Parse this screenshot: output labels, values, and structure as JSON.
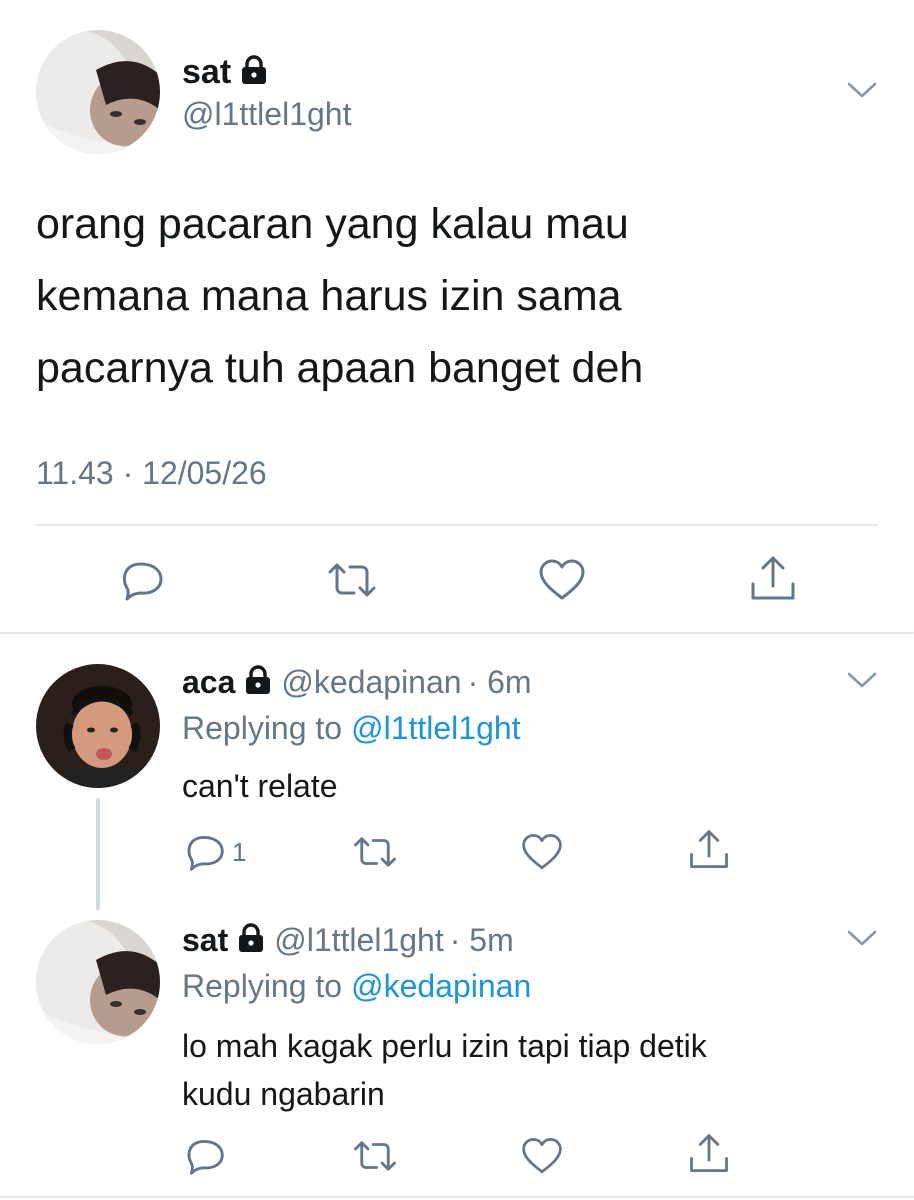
{
  "main_tweet": {
    "name": "sat",
    "handle": "@l1ttlel1ght",
    "text_lines": [
      "orang pacaran yang kalau mau",
      "kemana mana harus izin sama",
      "pacarnya tuh apaan banget deh"
    ],
    "timestamp": "11.43 · 12/05/26"
  },
  "replies": [
    {
      "name": "aca",
      "handle": "@kedapinan",
      "time": "· 6m",
      "replying_prefix": "Replying to",
      "replying_to": "@l1ttlel1ght",
      "text_lines": [
        "can't relate"
      ],
      "reply_count": "1"
    },
    {
      "name": "sat",
      "handle": "@l1ttlel1ght",
      "time": "· 5m",
      "replying_prefix": "Replying to",
      "replying_to": "@kedapinan",
      "text_lines": [
        "lo mah kagak perlu izin tapi tiap detik",
        "kudu ngabarin"
      ],
      "reply_count": ""
    }
  ],
  "icons": {
    "protected": "lock-icon",
    "menu": "chevron-down-icon",
    "reply": "reply-icon",
    "retweet": "retweet-icon",
    "like": "heart-icon",
    "share": "share-icon"
  },
  "colors": {
    "text": "#14171a",
    "muted": "#657786",
    "link": "#1b95e0",
    "divider": "#e1e8ed"
  }
}
